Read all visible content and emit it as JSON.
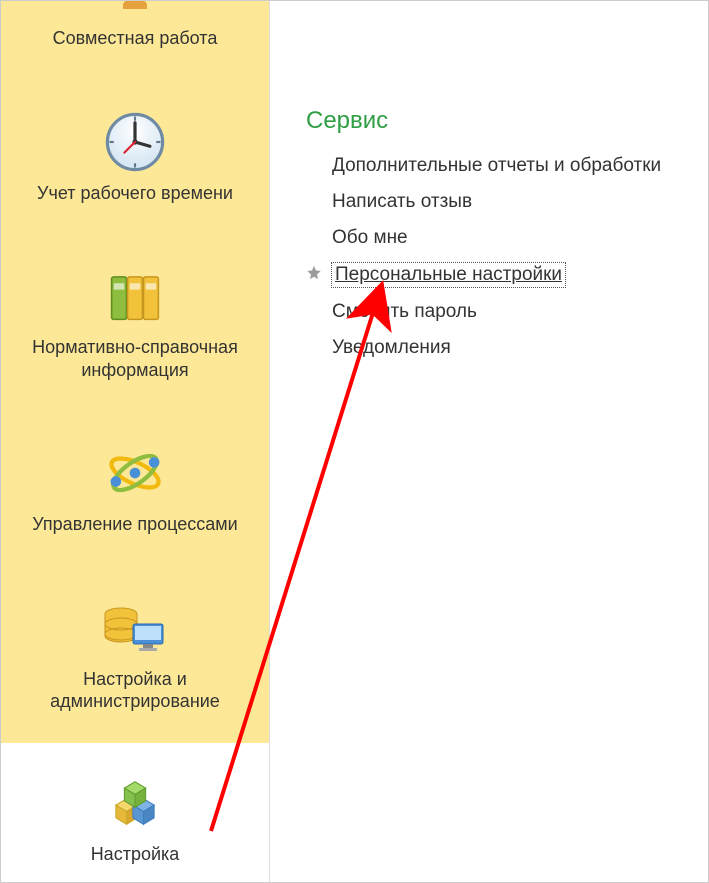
{
  "sidebar": {
    "items": [
      {
        "label": "Совместная работа"
      },
      {
        "label": "Учет рабочего времени"
      },
      {
        "label": "Нормативно-справочная информация"
      },
      {
        "label": "Управление процессами"
      },
      {
        "label": "Настройка и администрирование"
      },
      {
        "label": "Настройка"
      }
    ]
  },
  "content": {
    "section_title": "Сервис",
    "links": [
      {
        "label": "Дополнительные отчеты и обработки",
        "starred": false,
        "focused": false
      },
      {
        "label": "Написать отзыв",
        "starred": false,
        "focused": false
      },
      {
        "label": "Обо мне",
        "starred": false,
        "focused": false
      },
      {
        "label": "Персональные настройки",
        "starred": true,
        "focused": true
      },
      {
        "label": "Сменить пароль",
        "starred": false,
        "focused": false
      },
      {
        "label": "Уведомления",
        "starred": false,
        "focused": false
      }
    ]
  }
}
